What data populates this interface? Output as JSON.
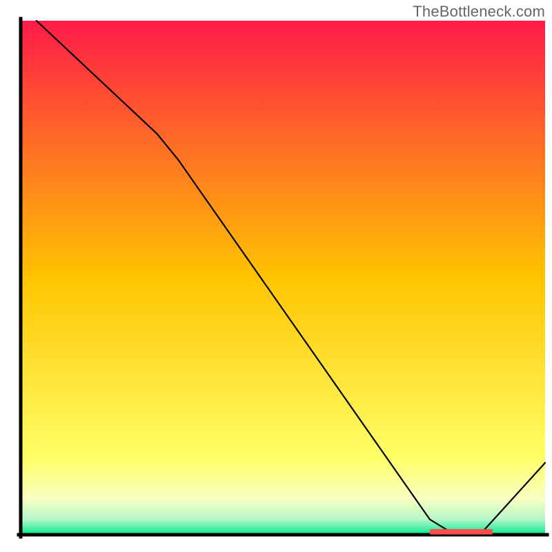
{
  "watermark": "TheBottleneck.com",
  "chart_data": {
    "type": "line",
    "title": "",
    "xlabel": "",
    "ylabel": "",
    "xlim": [
      0,
      100
    ],
    "ylim": [
      0,
      100
    ],
    "grid": false,
    "legend": false,
    "background_gradient": {
      "stops": [
        {
          "offset": 0.0,
          "color": "#ff1b48"
        },
        {
          "offset": 0.5,
          "color": "#ffc400"
        },
        {
          "offset": 0.85,
          "color": "#ffff66"
        },
        {
          "offset": 0.93,
          "color": "#f8ffc0"
        },
        {
          "offset": 0.97,
          "color": "#b6f7c9"
        },
        {
          "offset": 1.0,
          "color": "#00e98b"
        }
      ]
    },
    "axes_color": "#000000",
    "series": [
      {
        "name": "curve",
        "color": "#000000",
        "points": [
          {
            "x": 3,
            "y": 100
          },
          {
            "x": 26,
            "y": 78
          },
          {
            "x": 30,
            "y": 73
          },
          {
            "x": 78,
            "y": 3
          },
          {
            "x": 82,
            "y": 0.5
          },
          {
            "x": 88,
            "y": 0.5
          },
          {
            "x": 100,
            "y": 14
          }
        ]
      }
    ],
    "strip": {
      "name": "threshold-strip",
      "color": "#ff4d4d",
      "y": 0.5,
      "x_start": 78,
      "x_end": 90,
      "thickness": 2.2
    }
  }
}
